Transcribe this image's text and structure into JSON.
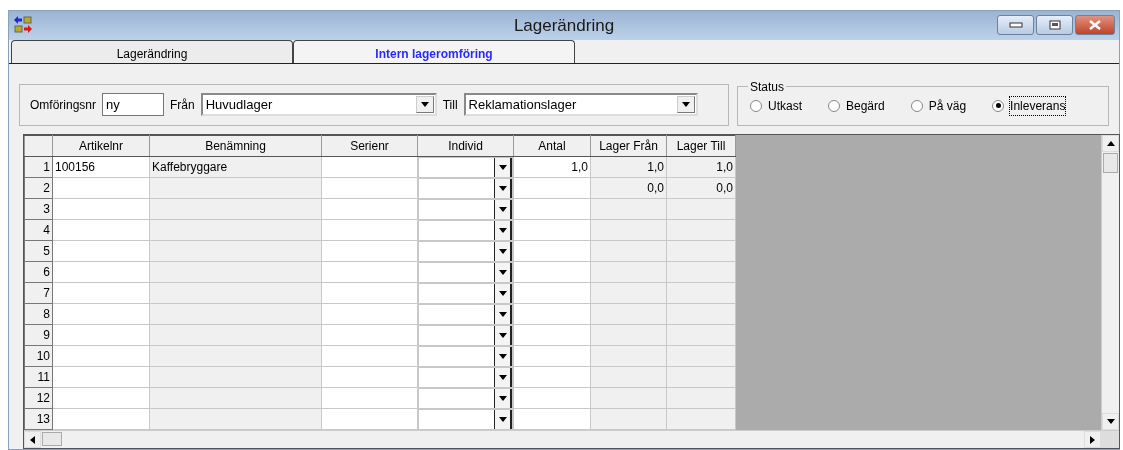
{
  "window": {
    "title": "Lagerändring"
  },
  "tabs": [
    {
      "label": "Lagerändring",
      "selected": false
    },
    {
      "label": "Intern lageromföring",
      "selected": true
    }
  ],
  "form": {
    "number_label": "Omföringsnr",
    "number_value": "ny",
    "from_label": "Från",
    "from_value": "Huvudlager",
    "to_label": "Till",
    "to_value": "Reklamationslager"
  },
  "status": {
    "title": "Status",
    "options": [
      {
        "label": "Utkast",
        "selected": false
      },
      {
        "label": "Begärd",
        "selected": false
      },
      {
        "label": "På väg",
        "selected": false
      },
      {
        "label": "Inleverans",
        "selected": true
      }
    ]
  },
  "table": {
    "columns": [
      "Artikelnr",
      "Benämning",
      "Serienr",
      "Individ",
      "Antal",
      "Lager Från",
      "Lager Till"
    ],
    "rows": [
      {
        "number": "1",
        "artikelnr": "100156",
        "benamning": "Kaffebryggare",
        "antal": "1,0",
        "lager_fran": "1,0",
        "lager_till": "1,0"
      },
      {
        "number": "2",
        "lager_fran": "0,0",
        "lager_till": "0,0"
      },
      {
        "number": "3"
      },
      {
        "number": "4"
      },
      {
        "number": "5"
      },
      {
        "number": "6"
      },
      {
        "number": "7"
      },
      {
        "number": "8"
      },
      {
        "number": "9"
      },
      {
        "number": "10"
      },
      {
        "number": "11"
      },
      {
        "number": "12"
      },
      {
        "number": "13"
      }
    ]
  }
}
